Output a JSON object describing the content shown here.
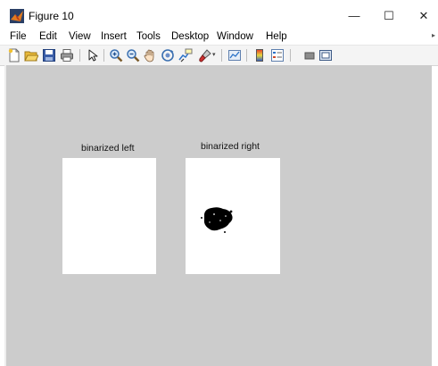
{
  "window": {
    "title": "Figure 10",
    "controls": {
      "minimize": "—",
      "maximize": "☐",
      "close": "✕"
    }
  },
  "menubar": {
    "items": [
      "File",
      "Edit",
      "View",
      "Insert",
      "Tools",
      "Desktop",
      "Window",
      "Help"
    ]
  },
  "toolbar": {
    "buttons": [
      "new-figure-icon",
      "open-file-icon",
      "save-icon",
      "print-icon",
      "edit-plot-icon",
      "zoom-in-icon",
      "zoom-out-icon",
      "pan-icon",
      "rotate-3d-icon",
      "data-cursor-icon",
      "brush-icon",
      "link-plot-icon",
      "insert-colorbar-icon",
      "insert-legend-icon",
      "hide-plot-tools-icon",
      "show-plot-tools-icon"
    ]
  },
  "figure": {
    "background": "#cccccc",
    "axes": [
      {
        "title": "binarized left"
      },
      {
        "title": "binarized right"
      }
    ]
  }
}
